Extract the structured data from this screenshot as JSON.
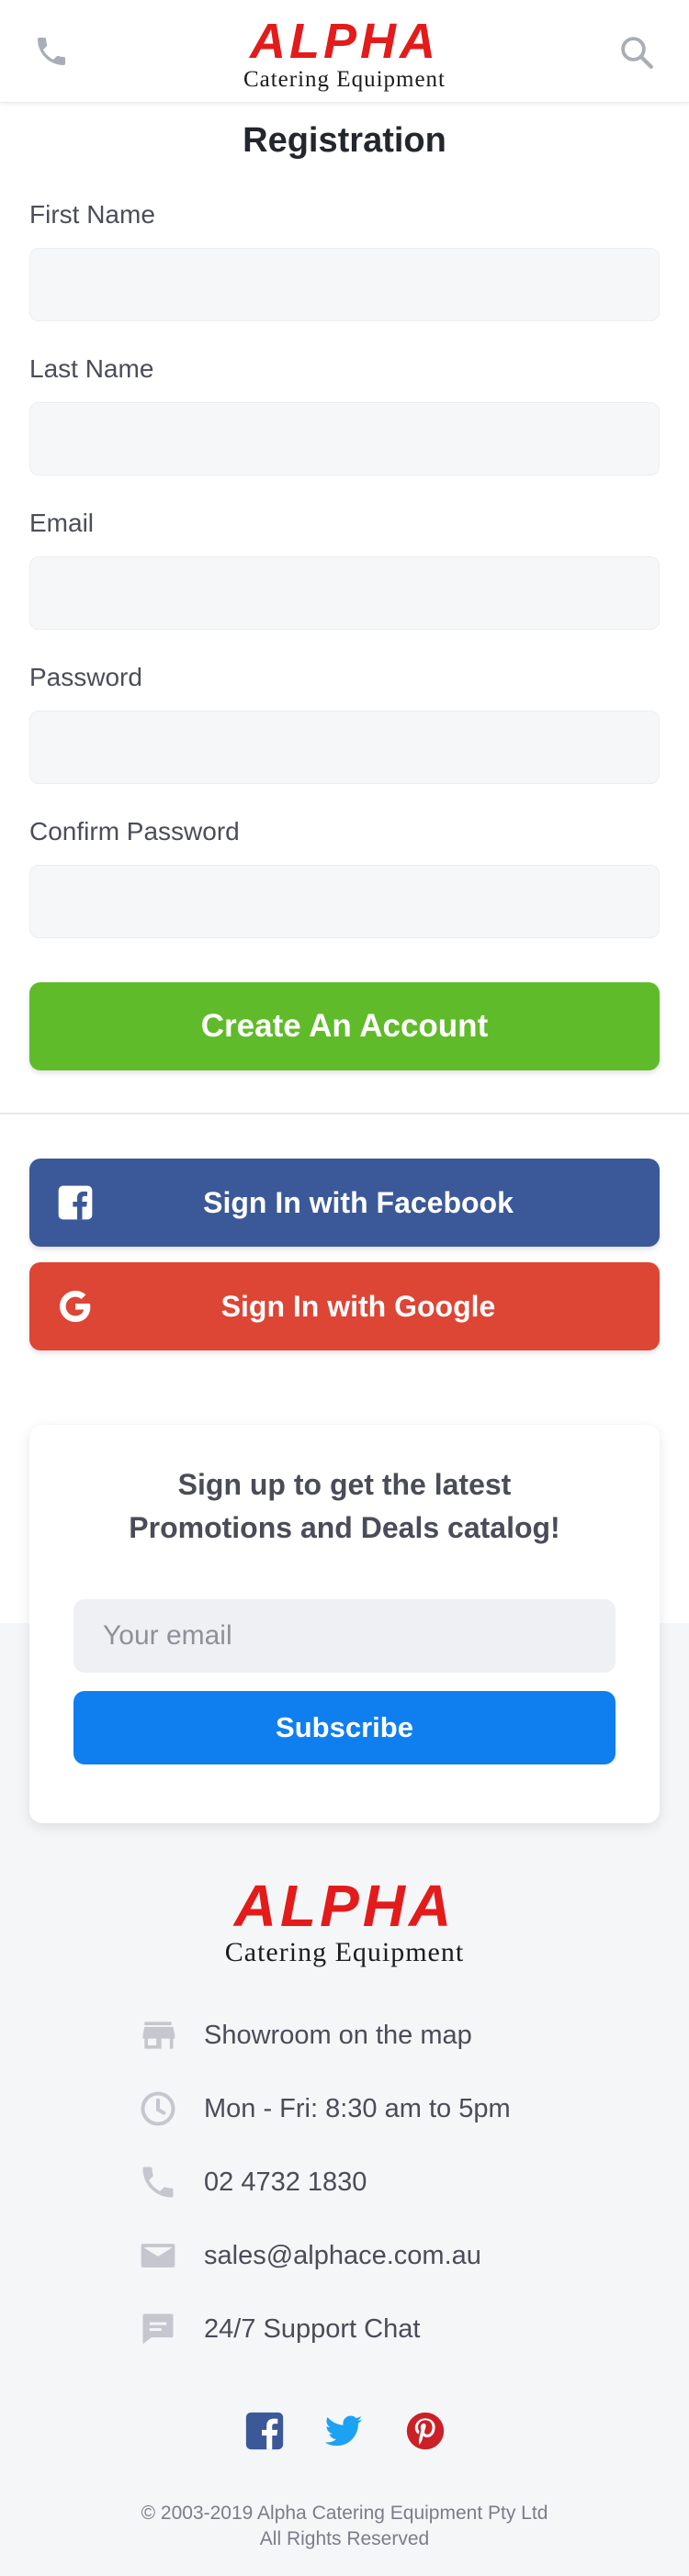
{
  "header": {
    "logo_brand": "ALPHA",
    "logo_sub": "Catering Equipment",
    "phone_icon": "phone-icon",
    "search_icon": "search-icon"
  },
  "registration": {
    "title": "Registration",
    "fields": [
      {
        "label": "First Name",
        "value": "",
        "placeholder": ""
      },
      {
        "label": "Last Name",
        "value": "",
        "placeholder": ""
      },
      {
        "label": "Email",
        "value": "",
        "placeholder": ""
      },
      {
        "label": "Password",
        "value": "",
        "placeholder": ""
      },
      {
        "label": "Confirm Password",
        "value": "",
        "placeholder": ""
      }
    ],
    "create_button": "Create An Account"
  },
  "social": {
    "facebook_label": "Sign In with Facebook",
    "google_label": "Sign In with Google"
  },
  "newsletter": {
    "line1": "Sign up to get the latest",
    "line2": "Promotions and Deals catalog!",
    "email_placeholder": "Your email",
    "subscribe_label": "Subscribe"
  },
  "footer": {
    "logo_brand": "ALPHA",
    "logo_sub": "Catering Equipment",
    "info": [
      {
        "icon": "store-icon",
        "text": "Showroom on the map"
      },
      {
        "icon": "clock-icon",
        "text": "Mon - Fri: 8:30 am to 5pm"
      },
      {
        "icon": "phone-icon",
        "text": "02 4732 1830"
      },
      {
        "icon": "mail-icon",
        "text": "sales@alphace.com.au"
      },
      {
        "icon": "chat-icon",
        "text": "24/7 Support Chat"
      }
    ],
    "social_icons": [
      "facebook-icon",
      "twitter-icon",
      "pinterest-icon"
    ],
    "copyright_line1": "© 2003-2019 Alpha Catering Equipment Pty Ltd",
    "copyright_line2": "All Rights Reserved"
  },
  "colors": {
    "brand_red": "#e41b1b",
    "create_green": "#5fbb29",
    "facebook_blue": "#3b5998",
    "google_red": "#dd4535",
    "subscribe_blue": "#0f7ff0",
    "twitter_blue": "#1da1f2",
    "pinterest_red": "#cb2027"
  }
}
